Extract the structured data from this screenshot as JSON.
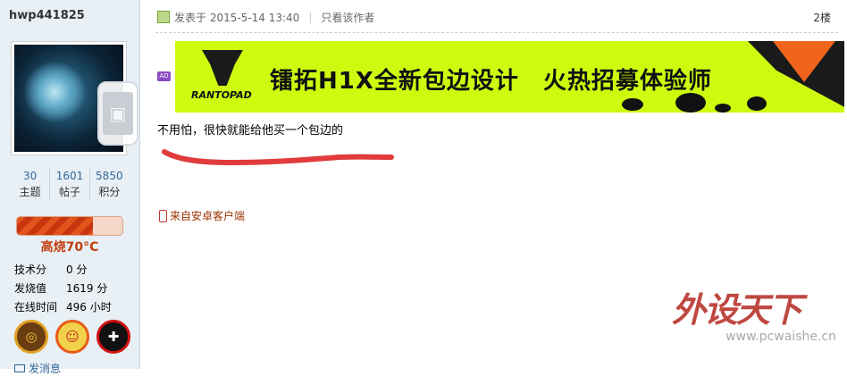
{
  "user": {
    "name": "hwp441825",
    "stats": [
      {
        "value": "30",
        "label": "主题"
      },
      {
        "value": "1601",
        "label": "帖子"
      },
      {
        "value": "5850",
        "label": "积分"
      }
    ],
    "heat": {
      "label": "高烧70°C",
      "level_fraction": 0.72
    },
    "info": [
      {
        "key": "技术分",
        "value": "0 分"
      },
      {
        "key": "发烧值",
        "value": "1619 分"
      },
      {
        "key": "在线时间",
        "value": "496 小时"
      }
    ],
    "badges": [
      {
        "icon": "shield-badge-icon",
        "glyph": "◎"
      },
      {
        "icon": "cartoon-bee-badge-icon",
        "glyph": "☺"
      },
      {
        "icon": "red-cross-badge-icon",
        "glyph": "✚"
      }
    ],
    "send_message": "发消息"
  },
  "post": {
    "posted_label": "发表于 2015-5-14 13:40",
    "only_author": "只看该作者",
    "floor": "2楼",
    "ad_tag": "AD",
    "banner": {
      "brand": "RANTOPAD",
      "text": "镭拓H1X全新包边设计　火热招募体验师",
      "bg_color": "#cdfa0f"
    },
    "content": "不用怕，很快就能给他买一个包边的",
    "client": "来自安卓客户端"
  },
  "watermark": {
    "brand": "外设天下",
    "url": "www.pcwaishe.cn"
  },
  "colors": {
    "sidebar_bg": "#e8eff5",
    "link": "#336699",
    "heat": "#c23d0c"
  }
}
